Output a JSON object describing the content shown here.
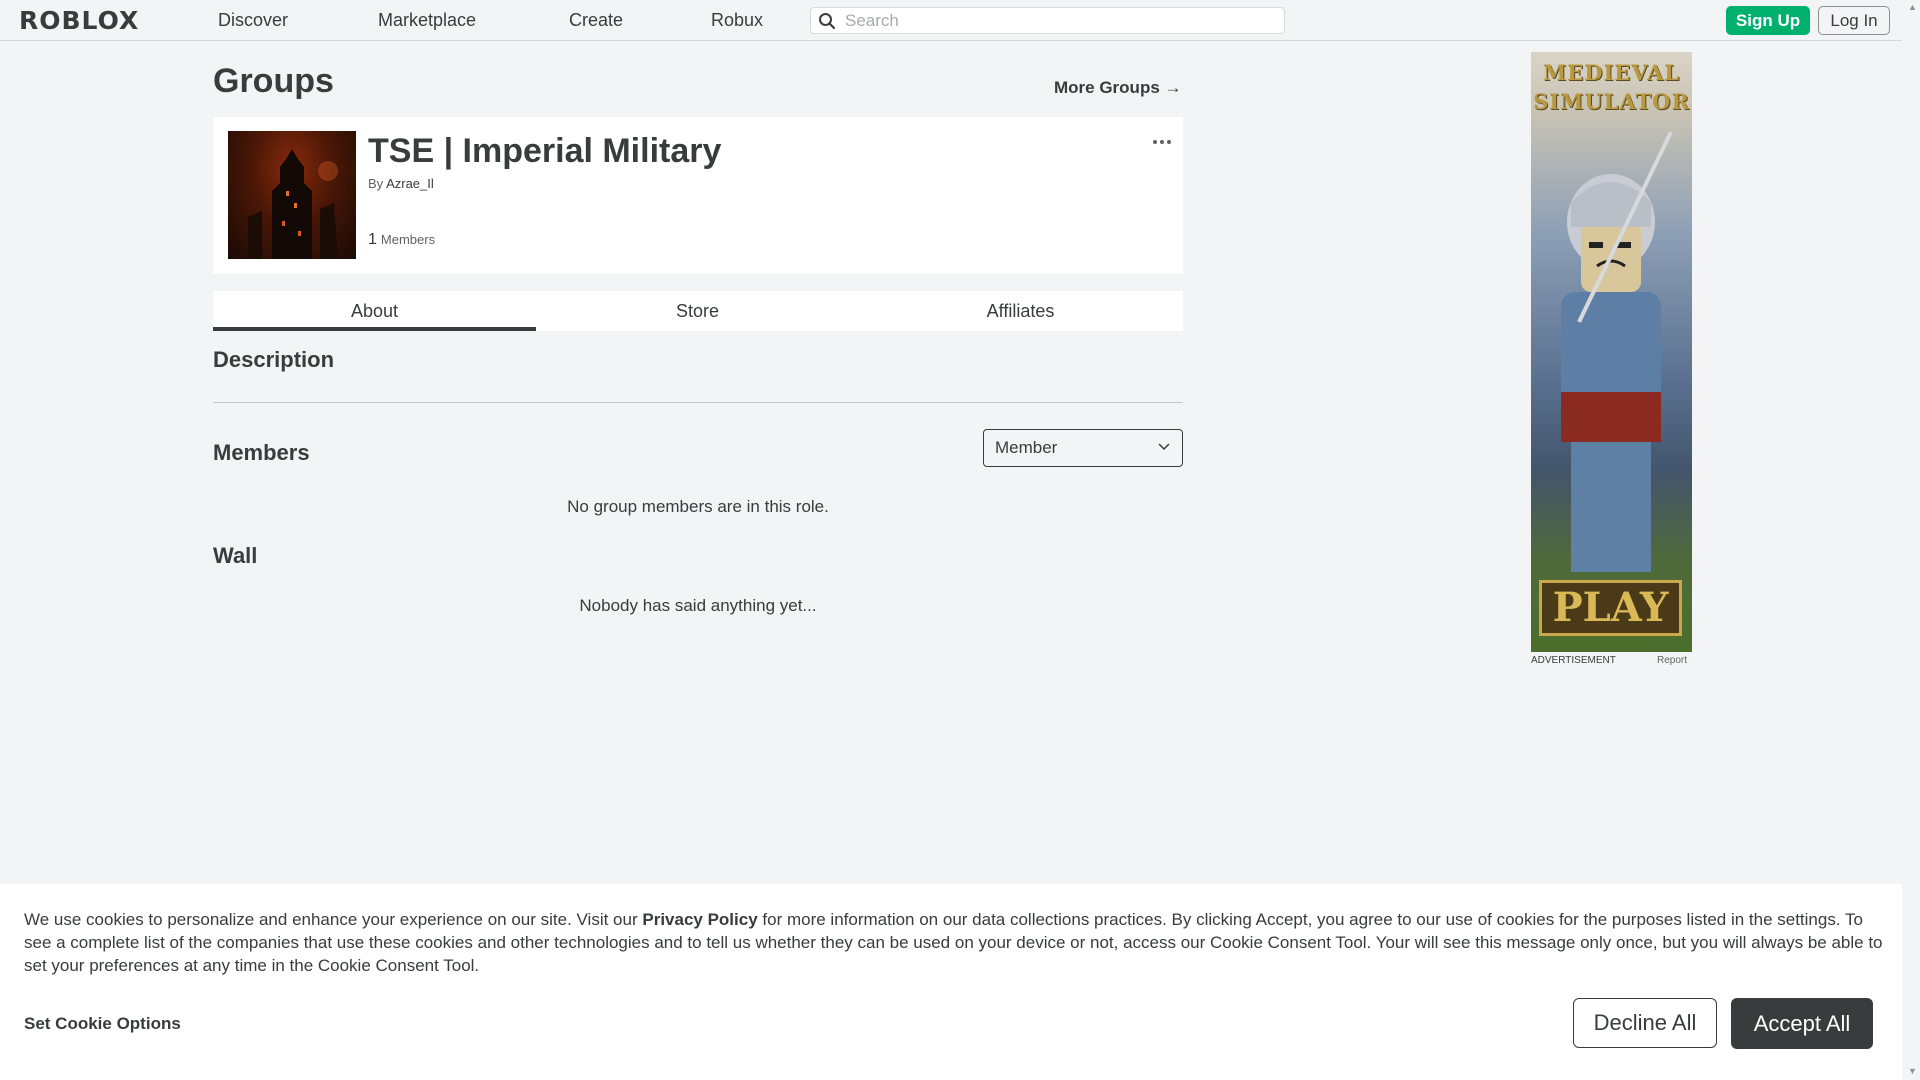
{
  "nav": {
    "logo": "ROBLOX",
    "links": [
      "Discover",
      "Marketplace",
      "Create",
      "Robux"
    ],
    "search_placeholder": "Search",
    "signup_label": "Sign Up",
    "login_label": "Log In"
  },
  "page": {
    "title": "Groups",
    "more_groups_label": "More Groups",
    "more_groups_arrow": "→"
  },
  "group": {
    "name": "TSE | Imperial Military",
    "owner_prefix": "By",
    "owner_name": "Azrae_Il",
    "member_count": "1",
    "member_label": "Members"
  },
  "tabs": [
    {
      "label": "About",
      "active": true
    },
    {
      "label": "Store",
      "active": false
    },
    {
      "label": "Affiliates",
      "active": false
    }
  ],
  "about": {
    "description_heading": "Description",
    "members_heading": "Members",
    "role_select_value": "Member",
    "members_empty": "No group members are in this role.",
    "wall_heading": "Wall",
    "wall_empty": "Nobody has said anything yet..."
  },
  "ad": {
    "title_line1": "MEDIEVAL",
    "title_line2": "SIMULATOR",
    "cta": "PLAY",
    "label": "ADVERTISEMENT",
    "report": "Report"
  },
  "cookie": {
    "text_before_link": "We use cookies to personalize and enhance your experience on our site. Visit our ",
    "link_text": "Privacy Policy",
    "text_after_link": " for more information on our data collections practices. By clicking Accept, you agree to our use of cookies for the purposes listed in the settings. To see a complete list of the companies that use these cookies and other technologies and to tell us whether they can be used on your device or not, access our Cookie Consent Tool. Your will see this message only once, but you will always be able to set your preferences at any time in the Cookie Consent Tool.",
    "options_label": "Set Cookie Options",
    "decline_label": "Decline All",
    "accept_label": "Accept All"
  }
}
